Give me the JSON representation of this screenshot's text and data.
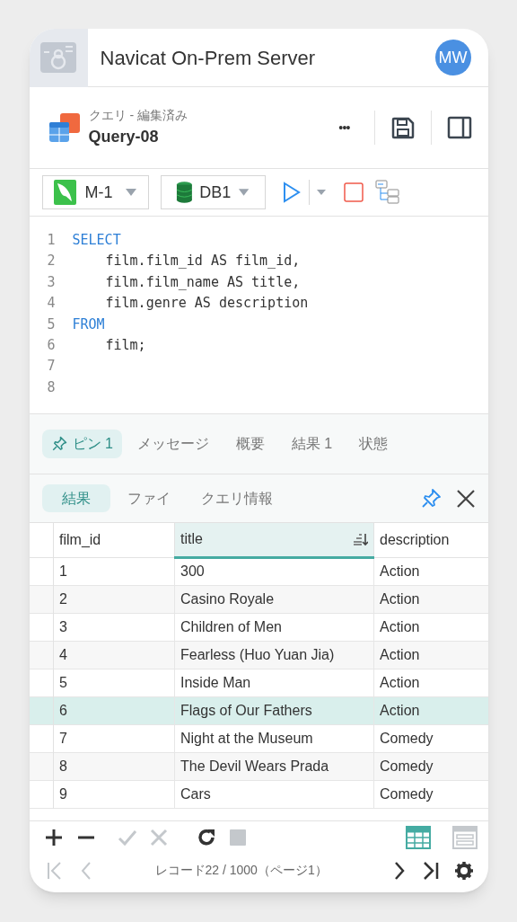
{
  "app_bar": {
    "title": "Navicat On-Prem Server",
    "avatar": "MW"
  },
  "query_header": {
    "subtitle": "クエリ - 編集済み",
    "title": "Query-08",
    "more": "•••"
  },
  "toolbar": {
    "connection": "M-1",
    "database": "DB1"
  },
  "editor": {
    "lines": [
      {
        "number": "1",
        "kind": "keyword",
        "indent": false,
        "text": "SELECT"
      },
      {
        "number": "2",
        "kind": "plain",
        "indent": true,
        "text": "film.film_id AS film_id,"
      },
      {
        "number": "3",
        "kind": "plain",
        "indent": true,
        "text": "film.film_name AS title,"
      },
      {
        "number": "4",
        "kind": "plain",
        "indent": true,
        "text": "film.genre AS description"
      },
      {
        "number": "5",
        "kind": "keyword",
        "indent": false,
        "text": "FROM"
      },
      {
        "number": "6",
        "kind": "plain",
        "indent": true,
        "text": "film;"
      },
      {
        "number": "7"
      },
      {
        "number": "8"
      }
    ]
  },
  "result_tabs": [
    {
      "label": "ピン 1",
      "pinned": true,
      "selected": true
    },
    {
      "label": "メッセージ",
      "pinned": false,
      "selected": false
    },
    {
      "label": "概要",
      "pinned": false,
      "selected": false
    },
    {
      "label": "結果 1",
      "pinned": false,
      "selected": false
    },
    {
      "label": "状態",
      "pinned": false,
      "selected": false
    }
  ],
  "sub_tabs": [
    {
      "label": "結果",
      "selected": true
    },
    {
      "label": "ファイ",
      "selected": false
    },
    {
      "label": "クエリ情報",
      "selected": false
    }
  ],
  "table": {
    "columns": [
      {
        "label": "film_id",
        "sorted": false
      },
      {
        "label": "title",
        "sorted": true
      },
      {
        "label": "description",
        "sorted": false
      }
    ],
    "rows": [
      {
        "cells": [
          "1",
          "300",
          "Action"
        ],
        "selected": false
      },
      {
        "cells": [
          "2",
          "Casino Royale",
          "Action"
        ],
        "selected": false
      },
      {
        "cells": [
          "3",
          "Children of Men",
          "Action"
        ],
        "selected": false
      },
      {
        "cells": [
          "4",
          "Fearless (Huo Yuan Jia)",
          "Action"
        ],
        "selected": false
      },
      {
        "cells": [
          "5",
          "Inside Man",
          "Action"
        ],
        "selected": false
      },
      {
        "cells": [
          "6",
          "Flags of Our Fathers",
          "Action"
        ],
        "selected": true
      },
      {
        "cells": [
          "7",
          "Night at the Museum",
          "Comedy"
        ],
        "selected": false
      },
      {
        "cells": [
          "8",
          "The Devil Wears Prada",
          "Comedy"
        ],
        "selected": false
      },
      {
        "cells": [
          "9",
          "Cars",
          "Comedy"
        ],
        "selected": false
      }
    ]
  },
  "footer": {
    "record_info": "レコード22 / 1000（ページ1）",
    "grid_view": true
  }
}
